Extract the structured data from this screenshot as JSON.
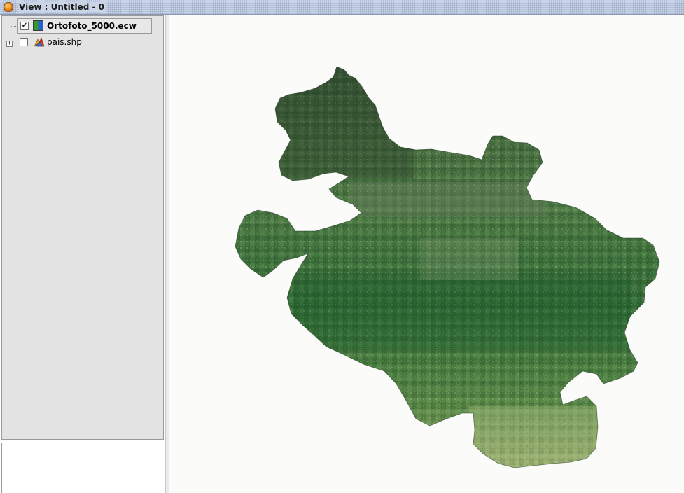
{
  "window": {
    "title": "View : Untitled - 0",
    "icon": "gvsig-app-icon"
  },
  "toc": {
    "layers": [
      {
        "name": "Ortofoto_5000.ecw",
        "visible": true,
        "selected": true,
        "type_icon": "raster-layer-icon",
        "expandable": false
      },
      {
        "name": "pais.shp",
        "visible": false,
        "selected": false,
        "type_icon": "vector-layer-icon",
        "expandable": true
      }
    ],
    "checkbox_checked_glyph": "✔",
    "expander_glyph": "+"
  },
  "map": {
    "content": "orthophoto raster mosaic of a region",
    "colors": {
      "background": "#fbfcfa",
      "vegetation_dark": "#1f4a1f",
      "vegetation_mid": "#3e7a3a",
      "vegetation_light": "#8aa860"
    }
  }
}
